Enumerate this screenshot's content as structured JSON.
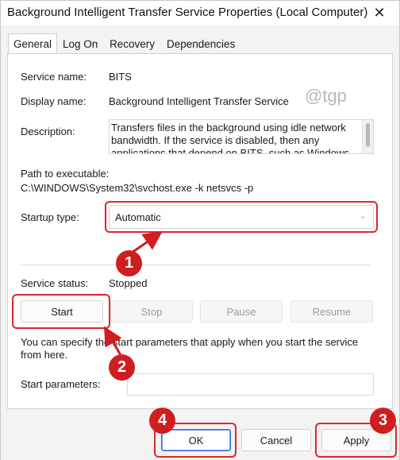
{
  "window": {
    "title": "Background Intelligent Transfer Service Properties (Local Computer)",
    "close_glyph": "✕"
  },
  "tabs": [
    {
      "label": "General",
      "active": true
    },
    {
      "label": "Log On",
      "active": false
    },
    {
      "label": "Recovery",
      "active": false
    },
    {
      "label": "Dependencies",
      "active": false
    }
  ],
  "general": {
    "service_name_label": "Service name:",
    "service_name_value": "BITS",
    "display_name_label": "Display name:",
    "display_name_value": "Background Intelligent Transfer Service",
    "description_label": "Description:",
    "description_value": "Transfers files in the background using idle network bandwidth. If the service is disabled, then any applications that depend on BITS, such as Windows",
    "path_label": "Path to executable:",
    "path_value": "C:\\WINDOWS\\System32\\svchost.exe -k netsvcs -p",
    "startup_type_label": "Startup type:",
    "startup_type_value": "Automatic",
    "service_status_label": "Service status:",
    "service_status_value": "Stopped",
    "buttons": {
      "start": "Start",
      "stop": "Stop",
      "pause": "Pause",
      "resume": "Resume"
    },
    "hint_text": "You can specify the start parameters that apply when you start the service from here.",
    "start_params_label": "Start parameters:",
    "start_params_value": ""
  },
  "watermark": "@tgp",
  "footer": {
    "ok": "OK",
    "cancel": "Cancel",
    "apply": "Apply"
  },
  "annotations": {
    "badge_1": "1",
    "badge_2": "2",
    "badge_3": "3",
    "badge_4": "4",
    "color": "#cf1d20"
  },
  "icons": {
    "close": "close-icon",
    "dropdown": "chevron-down-icon"
  }
}
